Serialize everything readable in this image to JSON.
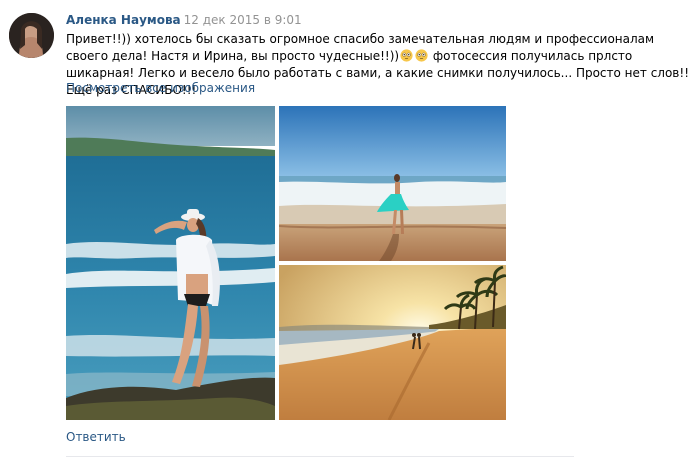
{
  "author": {
    "name": "Аленка Наумова",
    "date": "12 дек 2015 в 9:01"
  },
  "post": {
    "text_part1": "Привет!!)) хотелось бы сказать огромное спасибо замечательная людям и профессионалам своего дела! Настя и Ирина, вы просто чудесные!!))",
    "emoji_icon": "flushed-face-emoji",
    "text_part2": " фотосессия получилась прлсто шикарная! Легко и весело было работать с вами, а какие снимки получилось... Просто нет слов!! Ещё раз СПАСИБО!!!"
  },
  "links": {
    "view_all_images": "Посмотреть все изображения",
    "reply": "Ответить"
  },
  "colors": {
    "link": "#2a5885",
    "date": "#939393",
    "divider": "#e7e8ec"
  }
}
